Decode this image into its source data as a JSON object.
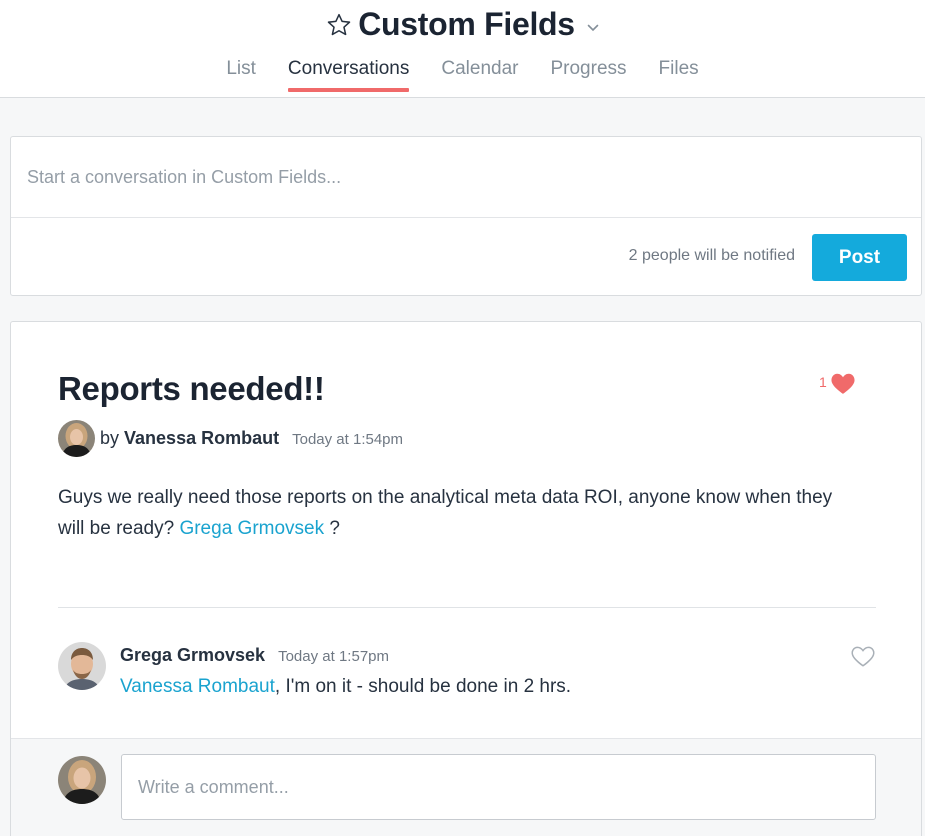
{
  "project": {
    "title": "Custom Fields"
  },
  "tabs": [
    {
      "label": "List",
      "active": false
    },
    {
      "label": "Conversations",
      "active": true
    },
    {
      "label": "Calendar",
      "active": false
    },
    {
      "label": "Progress",
      "active": false
    },
    {
      "label": "Files",
      "active": false
    }
  ],
  "compose": {
    "placeholder": "Start a conversation in Custom Fields...",
    "notify_text": "2 people will be notified",
    "post_label": "Post"
  },
  "conversation": {
    "title": "Reports needed!!",
    "like_count": "1",
    "by_label": "by",
    "author": "Vanessa Rombaut",
    "timestamp": "Today at 1:54pm",
    "body_text_before": "Guys we really need those reports on the analytical meta data ROI, anyone know when they will be ready?",
    "body_mention": "Grega Grmovsek",
    "body_text_after": "?",
    "reply": {
      "author": "Grega Grmovsek",
      "timestamp": "Today at 1:57pm",
      "mention": "Vanessa Rombaut",
      "text": ", I'm on it - should be done in 2 hrs."
    },
    "comment_placeholder": "Write a comment..."
  },
  "colors": {
    "accent_tab": "#f06a6a",
    "post_button": "#14aadc",
    "mention": "#1aa3cf",
    "heart": "#f06a6a"
  },
  "icons": [
    "star-icon",
    "chevron-down-icon",
    "heart-filled-icon",
    "heart-outline-icon",
    "avatar"
  ]
}
